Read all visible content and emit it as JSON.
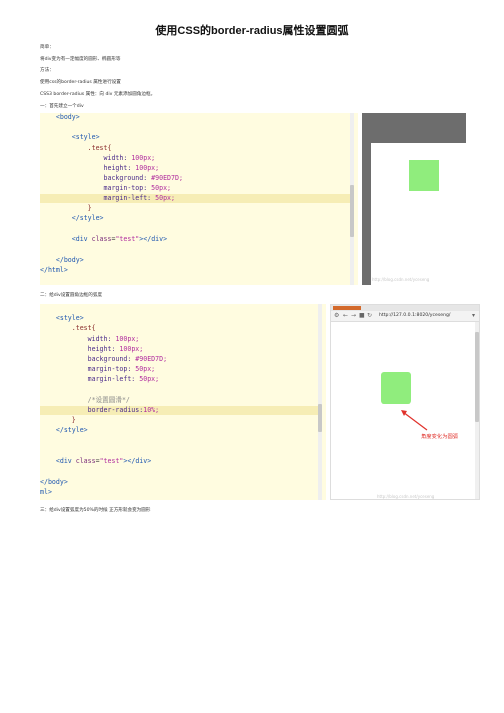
{
  "title": "使用CSS的border-radius属性设置圆弧",
  "intro": {
    "l1": "简单：",
    "l2": "将div变为有一定幅度的圆形、椭圆形等",
    "l3": "方法：",
    "l4": "使用css的border-radius 属性进行设置",
    "l5": "CSS3 border-radius 属性：向 div 元素添加圆角边框。",
    "l6": "一：首先建立一个div"
  },
  "step2": "二：给div设置圆角边框的弧度",
  "step3": "三：给div设置弧度为50%的时候 正方形就会变为圆形",
  "code1": {
    "l1": "    <body>",
    "l2": "        <style>",
    "l3": "            .test{",
    "l4p": "                width: ",
    "l4v": "100px;",
    "l5p": "                height: ",
    "l5v": "100px;",
    "l6p": "                background: ",
    "l6v": "#90ED7D;",
    "l7p": "                margin-top: ",
    "l7v": "50px;",
    "l8p": "                margin-left: ",
    "l8v": "50px;",
    "l9": "            }",
    "l10": "        </style>",
    "l11a": "        <div ",
    "l11b": "class",
    "l11c": "=",
    "l11d": "\"test\"",
    "l11e": "></div>",
    "l12": "    </body>",
    "l13": "</html>"
  },
  "code2": {
    "l1": "    <style>",
    "l2": "        .test{",
    "l3p": "            width: ",
    "l3v": "100px;",
    "l4p": "            height: ",
    "l4v": "100px;",
    "l5p": "            background: ",
    "l5v": "#90ED7D;",
    "l6p": "            margin-top: ",
    "l6v": "50px;",
    "l7p": "            margin-left: ",
    "l7v": "50px;",
    "l8": "            /*设置圆滑*/",
    "l9p": "            border-radius:",
    "l9v": "10%;",
    "l10": "        }",
    "l11": "    </style>",
    "l12a": "    <div ",
    "l12b": "class",
    "l12c": "=",
    "l12d": "\"test\"",
    "l12e": "></div>",
    "l13": "</body>",
    "l14": "ml>"
  },
  "browser2": {
    "url": "http://127.0.0.1:8020/yceseng/",
    "annotation": "角度变化为圆弧"
  },
  "watermarks": {
    "w1": "http://blog.csdn.net/yceseng",
    "w2": "http://blog.csdn.net/yceseng"
  },
  "colors": {
    "box": "#90ed7d",
    "code_bg": "#fffce0",
    "highlight": "#f6edb5",
    "annotation": "#e0312b"
  }
}
